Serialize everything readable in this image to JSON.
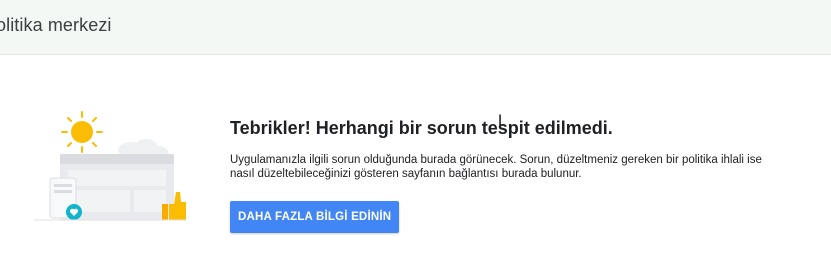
{
  "header": {
    "title": "olitika merkezi"
  },
  "main": {
    "headline": "Tebrikler! Herhangi bir sorun tespit edilmedi.",
    "description": "Uygulamanızla ilgili sorun olduğunda burada görünecek. Sorun, düzeltmeniz gereken bir politika ihlali ise nasıl düzeltebileceğinizi gösteren sayfanın bağlantısı burada bulunur.",
    "cta_label": "DAHA FAZLA BİLGİ EDİNİN"
  },
  "cursor_glyph": "I",
  "colors": {
    "header_bg": "#f3f8f5",
    "button_bg": "#4285f4",
    "sun": "#fbbc04",
    "teal_badge": "#12b5cb"
  },
  "icons": [
    "sun-icon",
    "browser-window-icon",
    "phone-icon",
    "heart-badge-icon",
    "thumbs-up-icon",
    "cloud-icon"
  ]
}
